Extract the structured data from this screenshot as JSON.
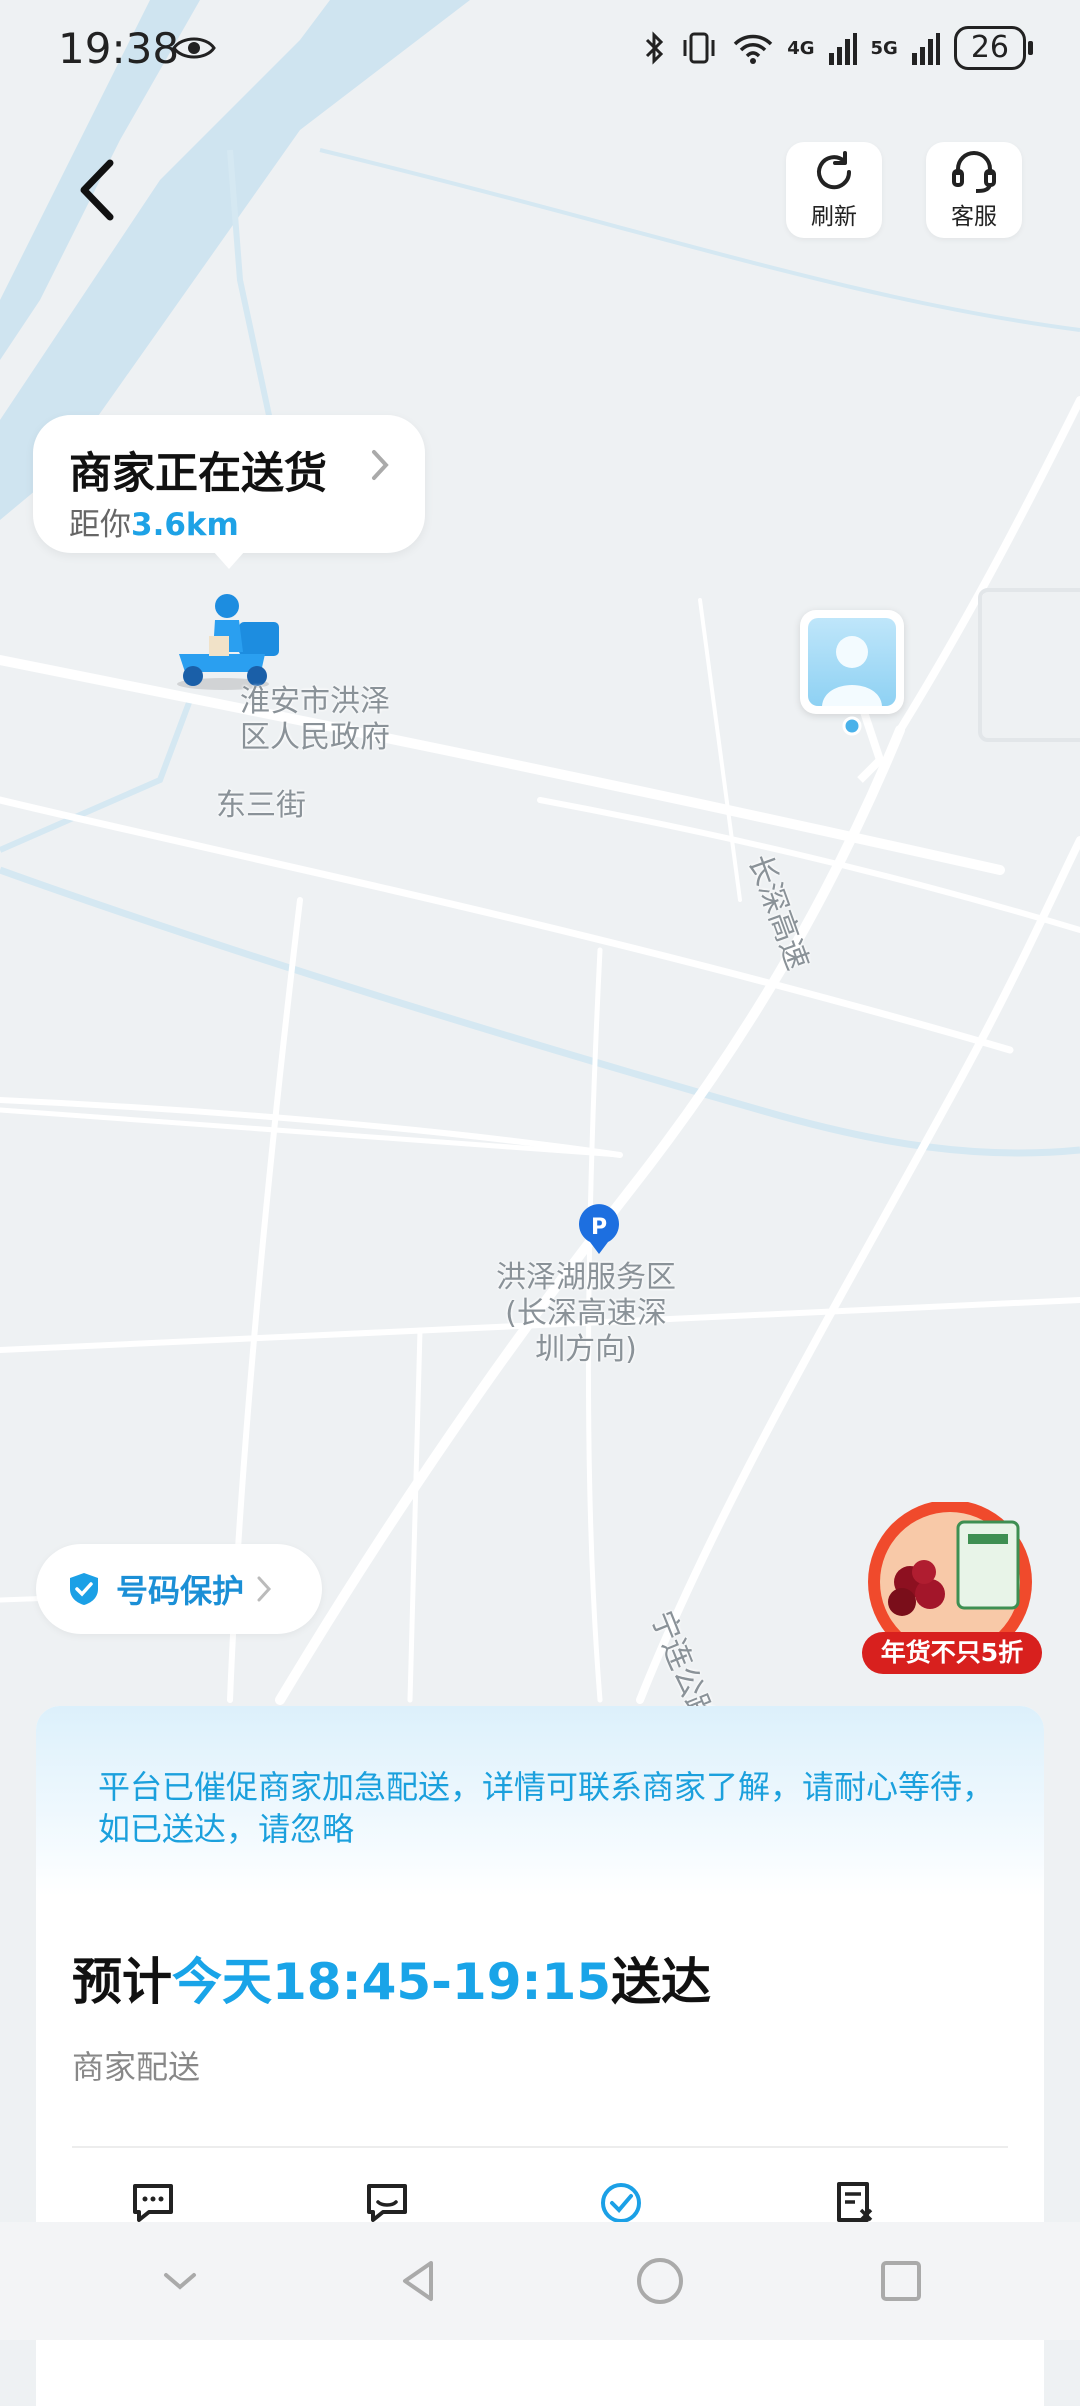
{
  "status_bar": {
    "time": "19:38",
    "network_4g": "4G",
    "network_5g": "5G",
    "battery": "26"
  },
  "top_actions": {
    "refresh_label": "刷新",
    "service_label": "客服"
  },
  "rider_bubble": {
    "title": "商家正在送货",
    "distance_prefix": "距你",
    "distance_value": "3.6km"
  },
  "map_labels": {
    "gov": "淮安市洪泽\n区人民政府",
    "street": "东三街",
    "highway": "长深高速",
    "service_area": "洪泽湖服务区\n(长深高速深\n圳方向)",
    "road2": "宁连公路"
  },
  "number_protect": {
    "label": "号码保护"
  },
  "promo": {
    "tag": "年货不只5折"
  },
  "sheet": {
    "notice": "平台已催促商家加急配送，详情可联系商家了解，请耐心等待，如已送达，请忽略",
    "eta_prefix": "预计",
    "eta_time": "今天18:45-19:15",
    "eta_suffix": "送达",
    "delivery_type": "商家配送"
  },
  "colors": {
    "accent": "#1ea2e6",
    "promo_red": "#d8201e"
  }
}
